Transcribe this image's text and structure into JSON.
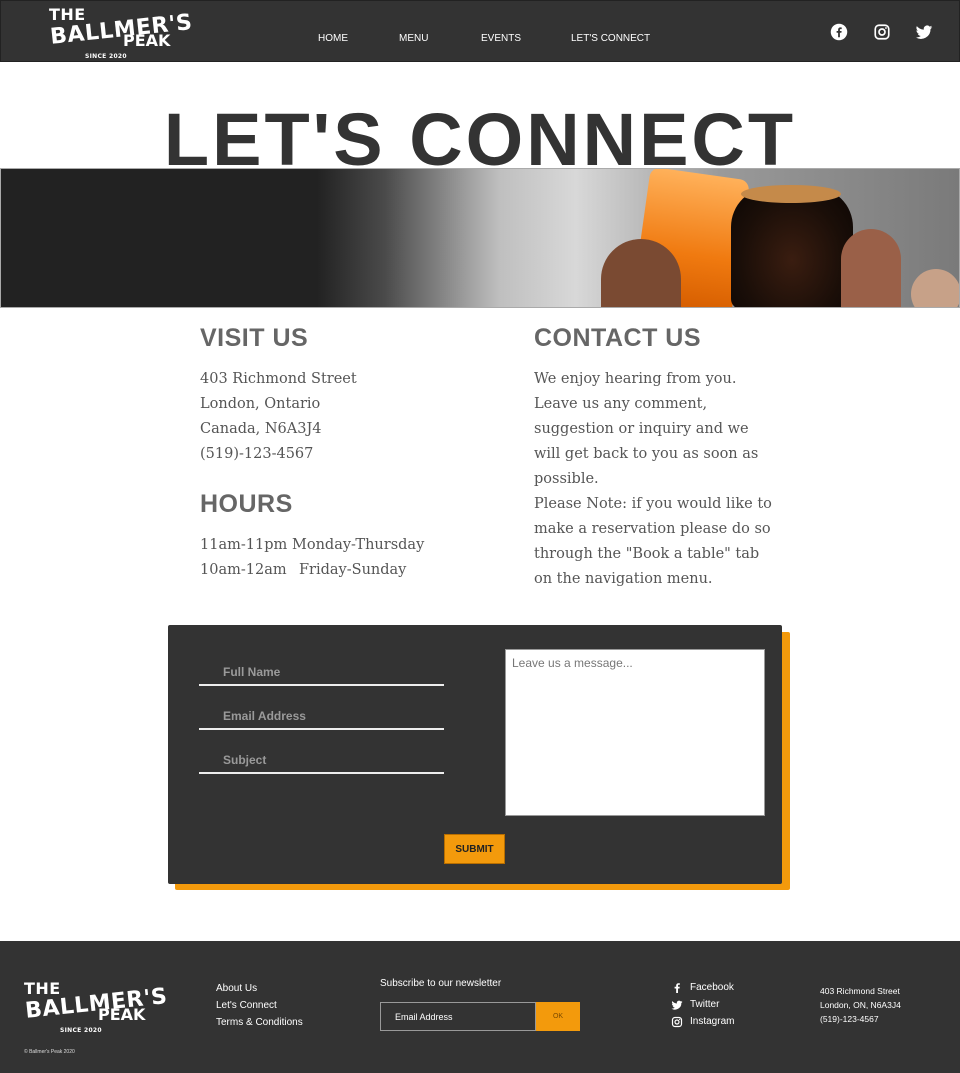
{
  "header": {
    "logo": {
      "line1": "THE",
      "line2": "BALLMER'S",
      "line3": "PEAK",
      "line4": "SINCE 2020"
    },
    "nav": [
      "HOME",
      "MENU",
      "EVENTS",
      "LET'S CONNECT"
    ],
    "social_icons": [
      "facebook-icon",
      "instagram-icon",
      "twitter-icon"
    ]
  },
  "page_title": "LET'S CONNECT",
  "visit": {
    "heading": "VISIT US",
    "lines": [
      "403 Richmond Street",
      "London, Ontario",
      "Canada, N6A3J4",
      "(519)-123-4567"
    ]
  },
  "hours": {
    "heading": "HOURS",
    "rows": [
      {
        "time": "11am-11pm",
        "days": "Monday-Thursday"
      },
      {
        "time": "10am-12am",
        "days": "Friday-Sunday"
      }
    ]
  },
  "contact": {
    "heading": "CONTACT US",
    "para1": "We enjoy hearing from you. Leave us any comment, suggestion or inquiry and we will get back to you as soon as possible.",
    "para2": "Please Note: if you would like to make a reservation please do so through the \"Book a table\" tab on the navigation menu."
  },
  "form": {
    "full_name_placeholder": "Full Name",
    "email_placeholder": "Email Address",
    "subject_placeholder": "Subject",
    "message_placeholder": "Leave us a message...",
    "submit_label": "SUBMIT"
  },
  "footer": {
    "logo": {
      "line1": "THE",
      "line2": "BALLMER'S",
      "line3": "PEAK",
      "line4": "SINCE 2020"
    },
    "copyright": "© Ballmer's Peak 2020",
    "links": [
      "About Us",
      "Let's Connect",
      "Terms & Conditions"
    ],
    "newsletter_label": "Subscribe to our newsletter",
    "newsletter_placeholder": "Email Address",
    "newsletter_button": "OK",
    "social": [
      "Facebook",
      "Twitter",
      "Instagram"
    ],
    "address": [
      "403 Richmond Street",
      "London, ON, N6A3J4",
      "(519)-123-4567"
    ]
  },
  "colors": {
    "dark": "#333333",
    "accent": "#f39a0c",
    "heading_gray": "#666666"
  }
}
